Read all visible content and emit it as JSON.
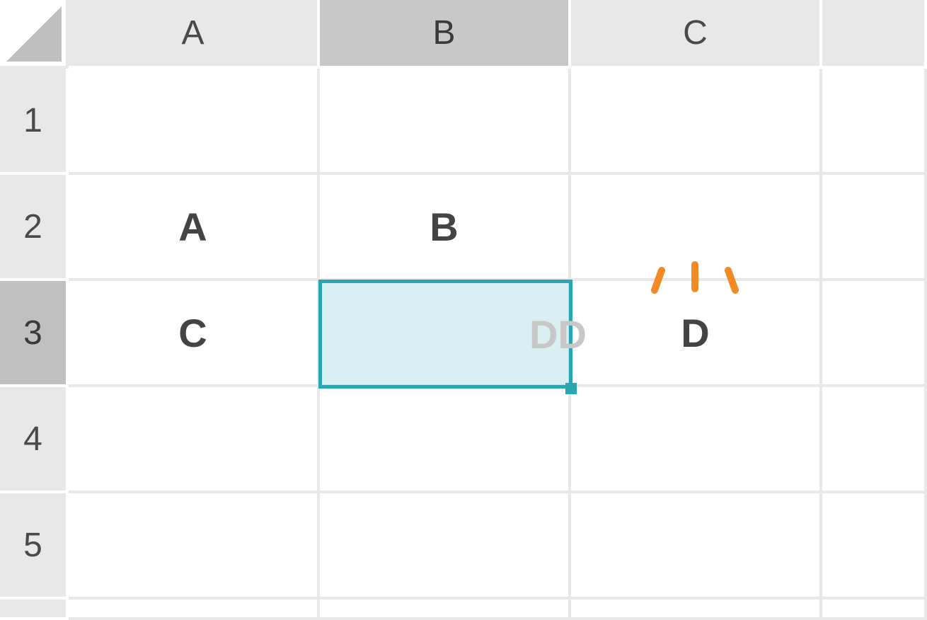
{
  "columns": [
    "A",
    "B",
    "C"
  ],
  "rows": [
    "1",
    "2",
    "3",
    "4",
    "5"
  ],
  "active_column_index": 1,
  "active_row_index": 2,
  "cells": {
    "A2": "A",
    "B2": "B",
    "A3": "C",
    "C3": "D"
  },
  "selection": {
    "cell": "B3"
  },
  "drag_ghost": {
    "text": "DD",
    "near_cell": "B3"
  },
  "accent_color": "#2aa6b0",
  "spark_color": "#f08a24"
}
